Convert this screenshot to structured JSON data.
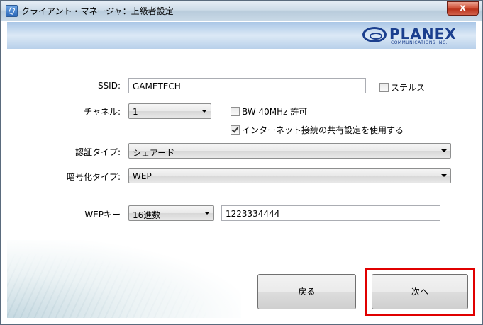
{
  "window": {
    "title": "クライアント・マネージャ：上級者設定",
    "close_glyph": "x"
  },
  "logo": {
    "brand": "PLANEX",
    "tagline": "COMMUNICATIONS INC."
  },
  "form": {
    "ssid": {
      "label": "SSID:",
      "value": "GAMETECH"
    },
    "stealth": {
      "label": "ステルス",
      "checked": false
    },
    "channel": {
      "label": "チャネル:",
      "value": "1"
    },
    "bw40": {
      "label": "BW 40MHz 許可",
      "checked": false
    },
    "ics": {
      "label": "インターネット接続の共有設定を使用する",
      "checked": true
    },
    "auth": {
      "label": "認証タイプ:",
      "value": "シェアード"
    },
    "encryption": {
      "label": "暗号化タイプ:",
      "value": "WEP"
    },
    "wep_key": {
      "label": "WEPキー",
      "format": "16進数",
      "value": "1223334444"
    }
  },
  "buttons": {
    "back": "戻る",
    "next": "次へ"
  },
  "colors": {
    "highlight": "#e00000",
    "brand": "#1b3f8e",
    "close": "#c8452d"
  }
}
